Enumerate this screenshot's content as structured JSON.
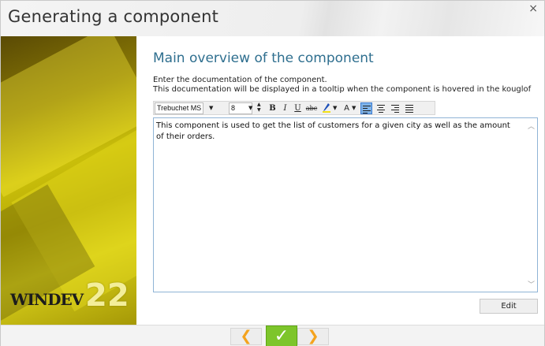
{
  "window": {
    "title": "Generating a component",
    "close_glyph": "×"
  },
  "branding": {
    "logo_text": "WINDEV",
    "version": "22"
  },
  "main": {
    "section_title": "Main overview of the component",
    "description_line1": "Enter the documentation of the component.",
    "description_line2": "This documentation will be displayed in a tooltip when the component is hovered in the kouglof"
  },
  "toolbar": {
    "font_name": "Trebuchet MS",
    "font_size": "8",
    "bold_label": "B",
    "italic_label": "I",
    "underline_label": "U",
    "strike_label": "abc",
    "font_color_label": "A"
  },
  "editor": {
    "content": "This component is used to get the list of customers for a given city as well as the amount of their orders."
  },
  "buttons": {
    "edit_label": "Edit",
    "prev_glyph": "❮",
    "ok_glyph": "✓",
    "next_glyph": "❯"
  },
  "colors": {
    "accent_title": "#2f6f8f",
    "ok_green": "#7dc52b",
    "nav_arrow_orange": "#f4a31e",
    "active_align": "#7fb4ea"
  },
  "icons": [
    "close-icon",
    "dropdown-arrow-icon",
    "spin-up-down-icon",
    "bold-icon",
    "italic-icon",
    "underline-icon",
    "strikethrough-icon",
    "highlight-pen-icon",
    "font-color-icon",
    "align-left-icon",
    "align-center-icon",
    "align-right-icon",
    "justify-icon",
    "scroll-up-icon",
    "scroll-down-icon",
    "chevron-left-icon",
    "checkmark-icon",
    "chevron-right-icon"
  ]
}
